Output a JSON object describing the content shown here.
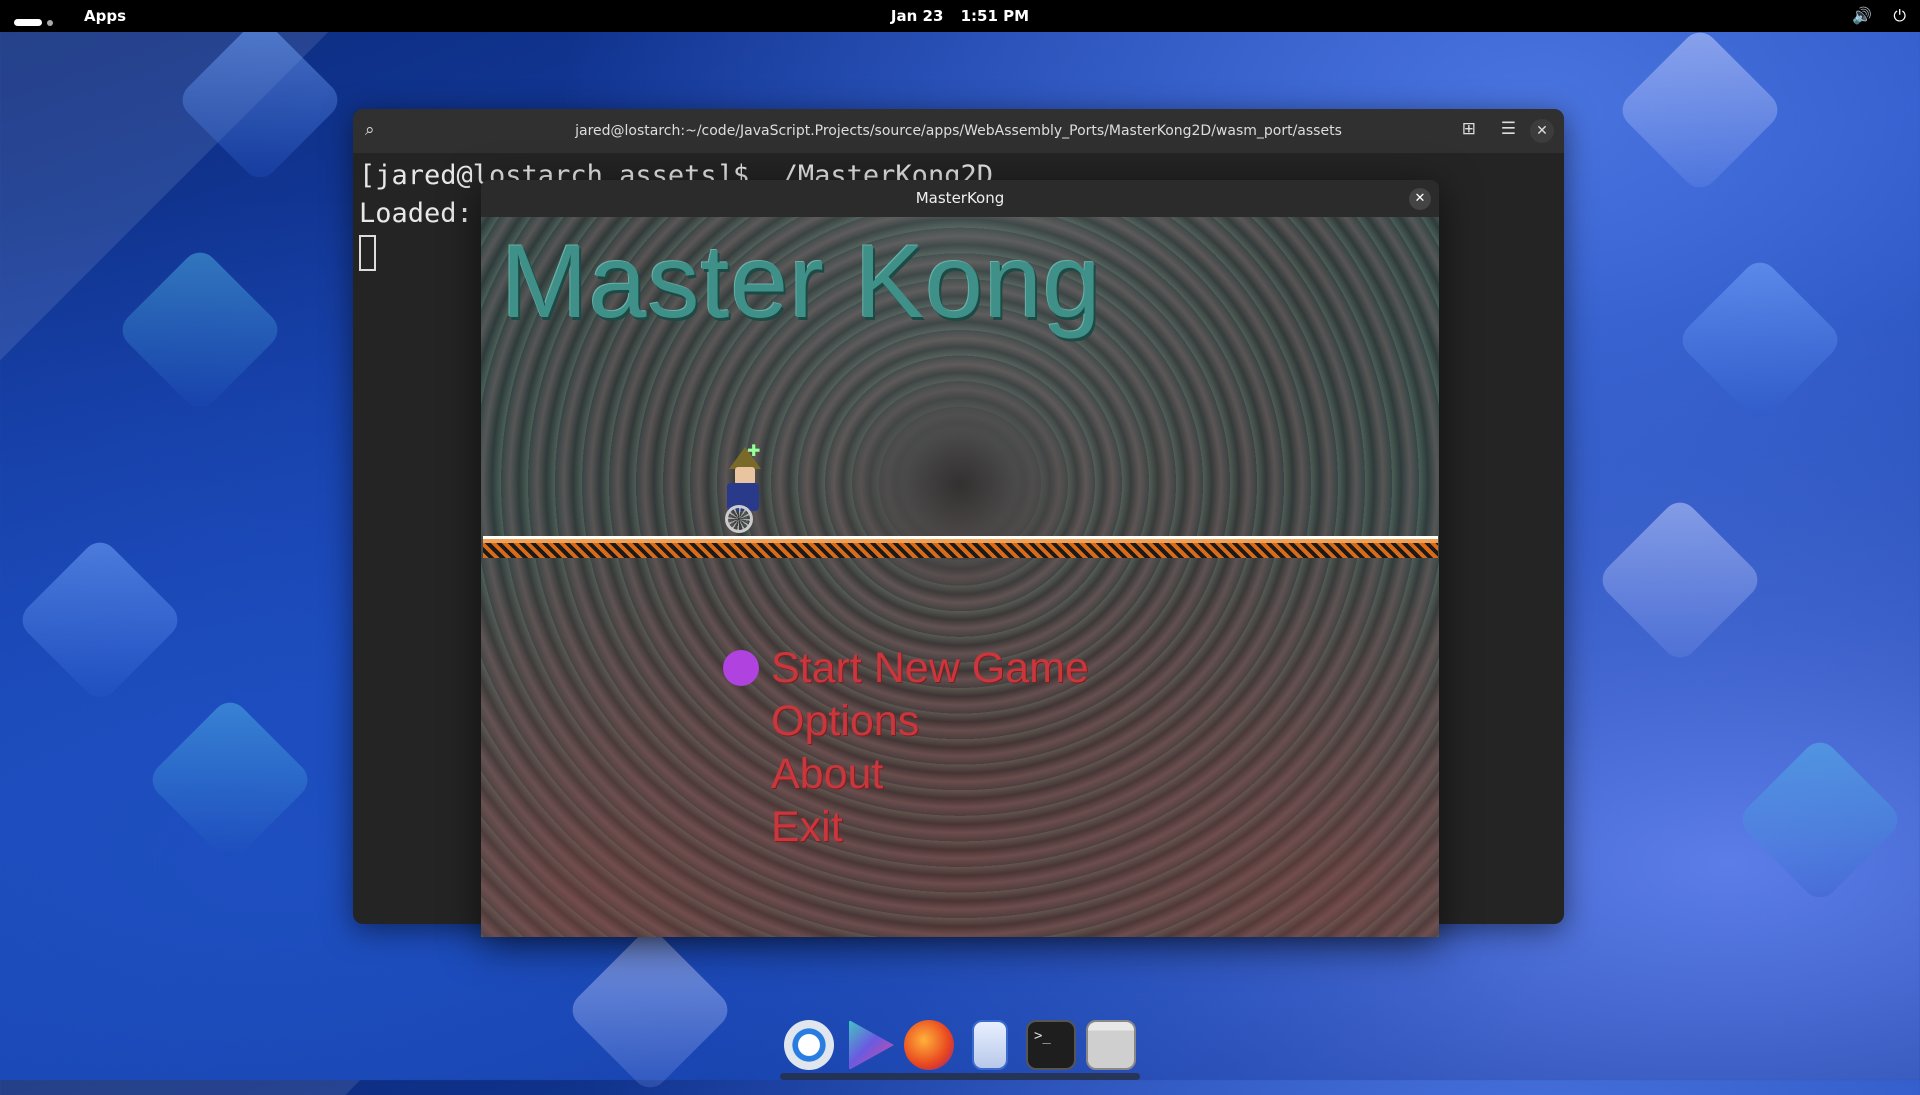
{
  "topbar": {
    "apps_label": "Apps",
    "date": "Jan 23",
    "time": "1:51 PM",
    "icons": [
      "volume-icon",
      "power-icon"
    ]
  },
  "terminal": {
    "title": "jared@lostarch:~/code/JavaScript.Projects/source/apps/WebAssembly_Ports/MasterKong2D/wasm_port/assets",
    "line1": "[jared@lostarch assets]$ ./MasterKong2D",
    "line2": "Loaded:",
    "icons": [
      "search-icon",
      "new-tab-icon",
      "menu-icon",
      "close-icon"
    ]
  },
  "game_window": {
    "title": "MasterKong",
    "logo": "Master Kong",
    "menu": [
      {
        "label": "Start New Game",
        "selected": true
      },
      {
        "label": "Options",
        "selected": false
      },
      {
        "label": "About",
        "selected": false
      },
      {
        "label": "Exit",
        "selected": false
      }
    ],
    "colors": {
      "logo": "#3f9088",
      "menu_text": "#c9363c",
      "bullet": "#b042e0",
      "platform": "#d96a18"
    }
  },
  "dock": {
    "items": [
      "chrome-icon",
      "play-store-icon",
      "firefox-icon",
      "files-icon",
      "terminal-icon",
      "window-icon"
    ]
  }
}
